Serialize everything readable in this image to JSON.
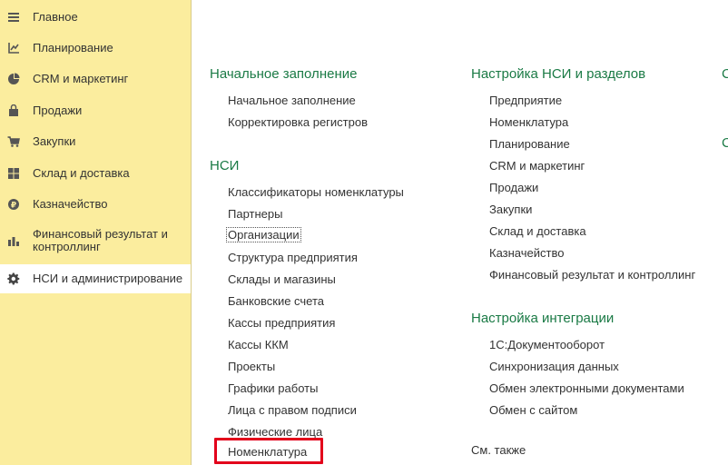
{
  "sidebar": {
    "items": [
      {
        "label": "Главное",
        "icon": "menu-lines-icon"
      },
      {
        "label": "Планирование",
        "icon": "planning-chart-icon"
      },
      {
        "label": "CRM и маркетинг",
        "icon": "pie-chart-icon"
      },
      {
        "label": "Продажи",
        "icon": "shopping-bag-icon"
      },
      {
        "label": "Закупки",
        "icon": "shopping-cart-icon"
      },
      {
        "label": "Склад и доставка",
        "icon": "warehouse-grid-icon"
      },
      {
        "label": "Казначейство",
        "icon": "coin-icon"
      },
      {
        "label": "Финансовый результат и контроллинг",
        "icon": "bar-chart-icon"
      },
      {
        "label": "НСИ и администрирование",
        "icon": "gear-icon"
      }
    ],
    "active_index": 8
  },
  "columns": {
    "left": {
      "sections": [
        {
          "title": "Начальное заполнение",
          "links": [
            "Начальное заполнение",
            "Корректировка регистров"
          ]
        },
        {
          "title": "НСИ",
          "links": [
            "Классификаторы номенклатуры",
            "Партнеры",
            "Организации",
            "Структура предприятия",
            "Склады и магазины",
            "Банковские счета",
            "Кассы предприятия",
            "Кассы ККМ",
            "Проекты",
            "Графики работы",
            "Лица с правом подписи",
            "Физические лица",
            "Номенклатура"
          ]
        }
      ]
    },
    "middle": {
      "sections": [
        {
          "title": "Настройка НСИ и разделов",
          "links": [
            "Предприятие",
            "Номенклатура",
            "Планирование",
            "CRM и маркетинг",
            "Продажи",
            "Закупки",
            "Склад и доставка",
            "Казначейство",
            "Финансовый результат и контроллинг"
          ]
        },
        {
          "title": "Настройка интеграции",
          "links": [
            "1С:Документооборот",
            "Синхронизация данных",
            "Обмен электронными документами",
            "Обмен с сайтом"
          ]
        }
      ],
      "see_also": "См. также"
    },
    "right_clipped": [
      "С",
      "С"
    ]
  },
  "colors": {
    "sidebar_bg": "#fbed9e",
    "section_title": "#1a7a45",
    "highlight_border": "#e3001b"
  }
}
